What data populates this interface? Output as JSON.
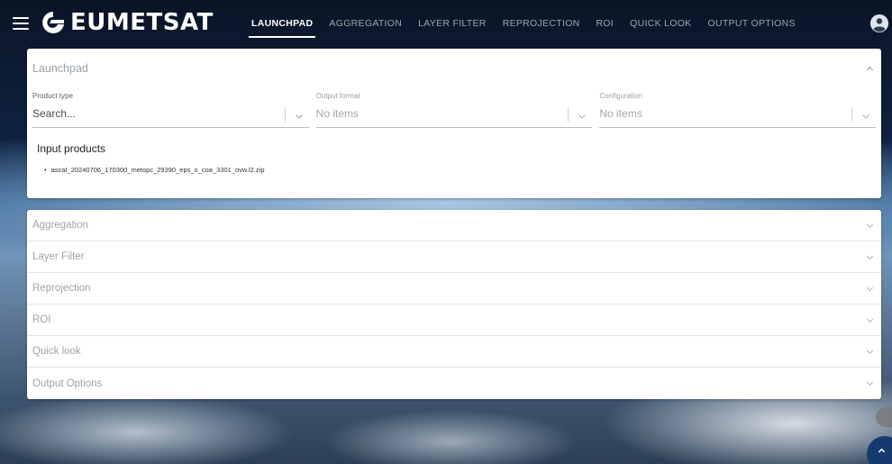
{
  "app": {
    "logo_text": "EUMETSAT"
  },
  "nav": {
    "tabs": [
      {
        "label": "LAUNCHPAD",
        "active": true
      },
      {
        "label": "AGGREGATION",
        "active": false
      },
      {
        "label": "LAYER FILTER",
        "active": false
      },
      {
        "label": "REPROJECTION",
        "active": false
      },
      {
        "label": "ROI",
        "active": false
      },
      {
        "label": "QUICK LOOK",
        "active": false
      },
      {
        "label": "OUTPUT OPTIONS",
        "active": false
      }
    ]
  },
  "launchpad": {
    "title": "Launchpad",
    "fields": [
      {
        "label": "Product type",
        "value": "Search...",
        "disabled": false
      },
      {
        "label": "Output format",
        "value": "No items",
        "disabled": true
      },
      {
        "label": "Configuration",
        "value": "No items",
        "disabled": true
      }
    ],
    "input_products_title": "Input products",
    "input_products": [
      "ascat_20240706_170300_metopc_29390_eps_o_coa_3301_ovw.l2.zip"
    ]
  },
  "sections": [
    "Aggregation",
    "Layer Filter",
    "Reprojection",
    "ROI",
    "Quick look",
    "Output Options"
  ],
  "icons": {
    "menu": "hamburger-menu-icon",
    "avatar": "account-circle-icon",
    "collapse": "chevron-up-icon",
    "expand": "chevron-down-icon",
    "fab": "chevron-up-icon"
  },
  "colors": {
    "accent": "#153a6e",
    "panel_bg": "#ffffff",
    "muted_text": "#a3a3a3"
  }
}
